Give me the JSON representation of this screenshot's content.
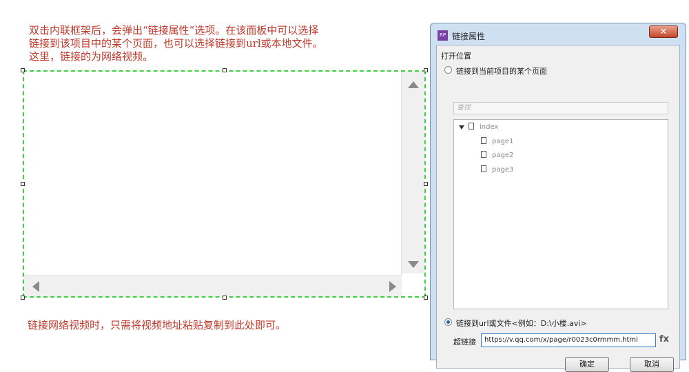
{
  "annotations": {
    "top_note": "双击内联框架后，会弹出“链接属性”选项。在该面板中可以选择\n链接到该项目中的某个页面，也可以选择链接到url或本地文件。\n这里，链接的为网络视频。",
    "bottom_note": "链接网络视频时，只需将视频地址粘贴复制到此处即可。"
  },
  "dialog": {
    "app_icon": "RP",
    "title": "链接属性",
    "close_label": "✕",
    "section_label": "打开位置",
    "option_page_label": "链接到当前项目的某个页面",
    "search_placeholder": "查找",
    "tree": {
      "root": "index",
      "children": [
        "page1",
        "page2",
        "page3"
      ]
    },
    "option_url_label": "链接到url或文件<例如：D:\\小楼.avi>",
    "url_label": "超链接",
    "url_value": "https://v.qq.com/x/page/r0023c0rmmm.html",
    "fx_label": "fx",
    "ok_label": "确定",
    "cancel_label": "取消",
    "selected_option": "url"
  },
  "colors": {
    "annotation": "#c0392b",
    "frame_border": "#3fcf3f",
    "dialog_bg": "#cfe0f2",
    "close_button": "#c4472a"
  },
  "icons": [
    "close-icon",
    "document-icon",
    "expand-triangle-icon",
    "scroll-up-arrow-icon",
    "scroll-down-arrow-icon",
    "scroll-left-arrow-icon",
    "scroll-right-arrow-icon",
    "radio-selected-icon"
  ]
}
